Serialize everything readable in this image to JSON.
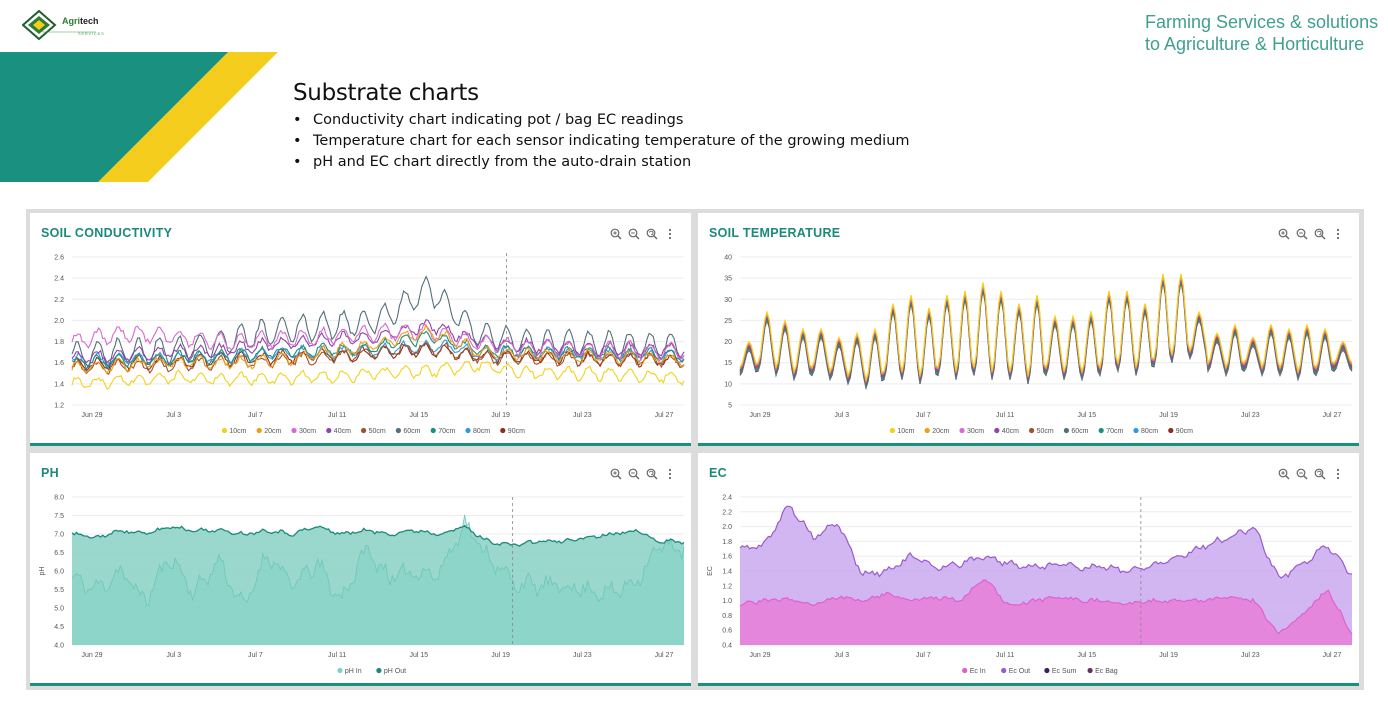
{
  "header": {
    "logo_text_main": "Agri",
    "logo_text_accent": "tech",
    "logo_sub": "SERVICES",
    "tagline_line1": "Farming Services & solutions",
    "tagline_line2": "to Agriculture & Horticulture",
    "banner_colors": {
      "teal": "#1a9080",
      "yellow": "#f5cd1c"
    }
  },
  "slide": {
    "title": "Substrate charts",
    "bullets": [
      "Conductivity chart indicating pot / bag EC readings",
      "Temperature chart for each sensor indicating temperature of the growing medium",
      "pH and EC chart directly from the auto-drain station"
    ]
  },
  "panels": {
    "conductivity": {
      "title": "SOIL CONDUCTIVITY"
    },
    "temperature": {
      "title": "SOIL TEMPERATURE"
    },
    "ph": {
      "title": "PH"
    },
    "ec": {
      "title": "EC"
    }
  },
  "toolbar_icons": [
    "zoom-in-icon",
    "zoom-out-icon",
    "zoom-reset-icon",
    "menu-icon"
  ],
  "chart_data": [
    {
      "id": "conductivity",
      "type": "line",
      "title": "SOIL CONDUCTIVITY",
      "x_ticks": [
        "Jun 29",
        "Jul 3",
        "Jul 7",
        "Jul 11",
        "Jul 15",
        "Jul 19",
        "Jul 23",
        "Jul 27"
      ],
      "y_ticks": [
        "1.2",
        "1.4",
        "1.6",
        "1.8",
        "2.0",
        "2.2",
        "2.4",
        "2.6"
      ],
      "ylim": [
        1.2,
        2.6
      ],
      "xlabel": "",
      "ylabel": "",
      "series": [
        {
          "name": "10cm",
          "color": "#f2d21b",
          "values": [
            1.4,
            1.43,
            1.46,
            1.45,
            1.45,
            1.47,
            1.5,
            1.52,
            1.58,
            1.5,
            1.5,
            1.48,
            1.45
          ]
        },
        {
          "name": "20cm",
          "color": "#f39c12",
          "values": [
            1.55,
            1.58,
            1.6,
            1.6,
            1.62,
            1.7,
            1.78,
            1.9,
            1.7,
            1.68,
            1.66,
            1.65,
            1.63
          ]
        },
        {
          "name": "30cm",
          "color": "#d86ad0",
          "values": [
            1.8,
            1.88,
            1.85,
            1.8,
            1.82,
            1.85,
            1.88,
            1.9,
            1.78,
            1.74,
            1.72,
            1.72,
            1.7
          ]
        },
        {
          "name": "40cm",
          "color": "#8e44ad",
          "values": [
            1.65,
            1.67,
            1.7,
            1.72,
            1.78,
            1.82,
            1.85,
            1.95,
            1.8,
            1.76,
            1.74,
            1.73,
            1.72
          ]
        },
        {
          "name": "50cm",
          "color": "#a0522d",
          "values": [
            1.55,
            1.57,
            1.58,
            1.6,
            1.62,
            1.65,
            1.7,
            1.75,
            1.65,
            1.64,
            1.63,
            1.63,
            1.62
          ]
        },
        {
          "name": "60cm",
          "color": "#546e7a",
          "values": [
            1.68,
            1.7,
            1.72,
            1.8,
            1.9,
            1.95,
            2.0,
            2.3,
            1.85,
            1.8,
            1.78,
            1.77,
            1.75
          ]
        },
        {
          "name": "70cm",
          "color": "#1a9080",
          "values": [
            1.6,
            1.62,
            1.64,
            1.66,
            1.7,
            1.72,
            1.75,
            1.85,
            1.72,
            1.7,
            1.69,
            1.68,
            1.67
          ]
        },
        {
          "name": "80cm",
          "color": "#3498db",
          "values": [
            1.62,
            1.63,
            1.64,
            1.66,
            1.68,
            1.7,
            1.72,
            1.76,
            1.7,
            1.69,
            1.68,
            1.67,
            1.66
          ]
        },
        {
          "name": "90cm",
          "color": "#8b2f1f",
          "values": [
            1.58,
            1.6,
            1.61,
            1.63,
            1.65,
            1.67,
            1.69,
            1.72,
            1.66,
            1.65,
            1.64,
            1.63,
            1.62
          ]
        }
      ]
    },
    {
      "id": "temperature",
      "type": "line",
      "title": "SOIL TEMPERATURE",
      "x_ticks": [
        "Jun 29",
        "Jul 3",
        "Jul 7",
        "Jul 11",
        "Jul 15",
        "Jul 19",
        "Jul 23",
        "Jul 27"
      ],
      "y_ticks": [
        "5",
        "10",
        "15",
        "20",
        "25",
        "30",
        "35",
        "40"
      ],
      "ylim": [
        5,
        40
      ],
      "xlabel": "",
      "ylabel": "",
      "daily_peaks": [
        19,
        26,
        24,
        22,
        22,
        20,
        21,
        22,
        28,
        30,
        27,
        30,
        31,
        33,
        31,
        28,
        30,
        25,
        25,
        26,
        31,
        31,
        28,
        35,
        35,
        26,
        21,
        23,
        20,
        23,
        22,
        23,
        22,
        19
      ],
      "daily_troughs": [
        13,
        14,
        13,
        12,
        13,
        12,
        11,
        10,
        12,
        12,
        11,
        13,
        12,
        13,
        12,
        12,
        11,
        13,
        12,
        12,
        13,
        14,
        13,
        15,
        16,
        17,
        14,
        13,
        14,
        13,
        13,
        12,
        13,
        14
      ],
      "series": [
        {
          "name": "10cm",
          "color": "#f2d21b"
        },
        {
          "name": "20cm",
          "color": "#f39c12"
        },
        {
          "name": "30cm",
          "color": "#d86ad0"
        },
        {
          "name": "40cm",
          "color": "#8e44ad"
        },
        {
          "name": "50cm",
          "color": "#a0522d"
        },
        {
          "name": "60cm",
          "color": "#546e7a"
        },
        {
          "name": "70cm",
          "color": "#1a9080"
        },
        {
          "name": "80cm",
          "color": "#3498db"
        },
        {
          "name": "90cm",
          "color": "#8b2f1f"
        }
      ]
    },
    {
      "id": "ph",
      "type": "area",
      "title": "PH",
      "x_ticks": [
        "Jun 29",
        "Jul 3",
        "Jul 7",
        "Jul 11",
        "Jul 15",
        "Jul 19",
        "Jul 23",
        "Jul 27"
      ],
      "y_ticks": [
        "4.0",
        "4.5",
        "5.0",
        "5.5",
        "6.0",
        "6.5",
        "7.0",
        "7.5",
        "8.0"
      ],
      "ylim": [
        4.0,
        8.0
      ],
      "xlabel": "",
      "ylabel": "pH",
      "series": [
        {
          "name": "pH In",
          "color": "#7fd1c6",
          "values": [
            5.8,
            5.5,
            6.0,
            5.2,
            6.4,
            5.4,
            6.3,
            5.0,
            6.5,
            5.6,
            6.2,
            5.2,
            6.6,
            5.8,
            6.0,
            5.9,
            7.3,
            6.4,
            5.7,
            5.6,
            5.6,
            5.5,
            5.4,
            5.7,
            6.7,
            6.6
          ]
        },
        {
          "name": "pH Out",
          "color": "#1a8a7a",
          "values": [
            7.0,
            6.9,
            7.1,
            7.0,
            7.2,
            7.1,
            7.1,
            7.0,
            7.1,
            7.0,
            7.2,
            7.0,
            7.1,
            7.0,
            7.1,
            7.0,
            7.2,
            6.8,
            6.7,
            6.8,
            6.8,
            6.9,
            7.0,
            7.1,
            6.8,
            6.8
          ]
        }
      ]
    },
    {
      "id": "ec",
      "type": "area",
      "title": "EC",
      "x_ticks": [
        "Jun 29",
        "Jul 3",
        "Jul 7",
        "Jul 11",
        "Jul 15",
        "Jul 19",
        "Jul 23",
        "Jul 27"
      ],
      "y_ticks": [
        "0.4",
        "0.6",
        "0.8",
        "1.0",
        "1.2",
        "1.4",
        "1.6",
        "1.8",
        "2.0",
        "2.2",
        "2.4"
      ],
      "ylim": [
        0.4,
        2.4
      ],
      "xlabel": "",
      "ylabel": "EC",
      "series": [
        {
          "name": "Ec In",
          "color": "#e05ccf",
          "values": [
            0.95,
            1.0,
            1.02,
            0.95,
            1.05,
            1.0,
            1.1,
            1.0,
            1.05,
            1.0,
            1.3,
            0.92,
            1.0,
            1.05,
            1.0,
            1.0,
            0.95,
            1.0,
            1.0,
            1.0,
            1.05,
            1.0,
            0.55,
            0.8,
            1.15,
            0.55
          ]
        },
        {
          "name": "Ec Out",
          "color": "#9b59d0",
          "values": [
            1.7,
            1.75,
            2.3,
            1.85,
            2.05,
            1.35,
            1.4,
            1.6,
            1.45,
            1.5,
            1.6,
            1.5,
            1.45,
            1.5,
            1.45,
            1.45,
            1.4,
            1.5,
            1.6,
            1.75,
            1.85,
            2.0,
            1.3,
            1.5,
            1.75,
            1.35
          ]
        },
        {
          "name": "Ec Sum",
          "color": "#3b1f5f"
        },
        {
          "name": "Ec Bag",
          "color": "#6b2f5f"
        }
      ]
    }
  ]
}
